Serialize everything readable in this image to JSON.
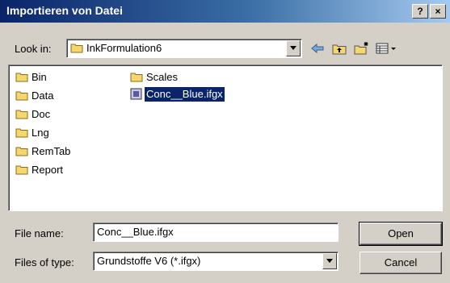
{
  "window": {
    "title": "Importieren von Datei",
    "help": "?",
    "close": "×"
  },
  "lookin": {
    "label": "Look in:",
    "value": "InkFormulation6"
  },
  "toolbar": [
    "back-icon",
    "up-folder-icon",
    "new-folder-icon",
    "view-menu-icon"
  ],
  "files": [
    {
      "name": "Bin",
      "type": "folder"
    },
    {
      "name": "Data",
      "type": "folder"
    },
    {
      "name": "Doc",
      "type": "folder"
    },
    {
      "name": "Lng",
      "type": "folder"
    },
    {
      "name": "RemTab",
      "type": "folder"
    },
    {
      "name": "Report",
      "type": "folder"
    },
    {
      "name": "Scales",
      "type": "folder"
    },
    {
      "name": "Conc__Blue.ifgx",
      "type": "file",
      "selected": true
    }
  ],
  "filename": {
    "label": "File name:",
    "value": "Conc__Blue.ifgx"
  },
  "filetype": {
    "label": "Files of type:",
    "value": "Grundstoffe V6 (*.ifgx)"
  },
  "buttons": {
    "open": "Open",
    "cancel": "Cancel"
  },
  "colors": {
    "titlebar_start": "#0a246a",
    "titlebar_end": "#a6caf0",
    "selection": "#0a246a",
    "folder": "#f5d76e"
  }
}
